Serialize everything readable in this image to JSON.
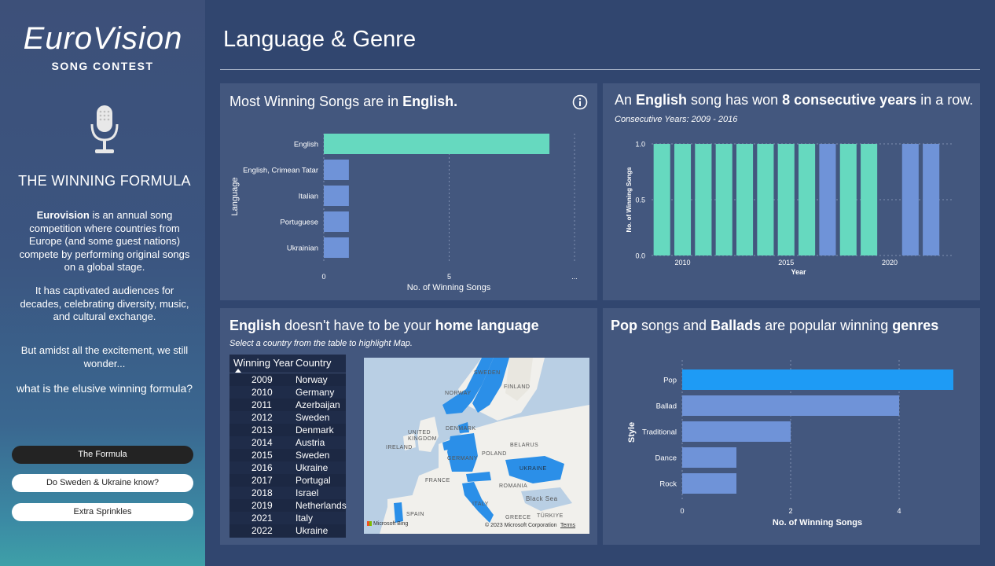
{
  "sidebar": {
    "logo_main": "EUROVISION",
    "logo_sub": "SONG CONTEST",
    "heading": "THE WINNING FORMULA",
    "intro_bold": "Eurovision",
    "intro_rest": " is an annual song competition where countries from Europe (and some guest nations) compete by performing original songs on a global stage.",
    "intro2": "It has captivated audiences for decades, celebrating diversity, music, and cultural exchange.",
    "intro3": "But amidst all the excitement, we still wonder...",
    "question": "what is the elusive winning formula?",
    "nav": [
      {
        "label": "The Formula",
        "active": true
      },
      {
        "label": "Do Sweden & Ukraine know?",
        "active": false
      },
      {
        "label": "Extra Sprinkles",
        "active": false
      }
    ]
  },
  "page_title": "Language & Genre",
  "cards": {
    "language": {
      "title_pre": "Most Winning Songs are in ",
      "title_bold": "English.",
      "ylabel": "Language",
      "xlabel": "No. of Winning Songs",
      "ellipsis": "..."
    },
    "consecutive": {
      "title_pre": "An ",
      "title_b1": "English",
      "title_mid": " song has won ",
      "title_b2": "8 consecutive years",
      "title_post": " in a row.",
      "subtitle": "Consecutive Years: 2009 - 2016",
      "ylabel": "No. of Winning Songs",
      "xlabel": "Year"
    },
    "home_language": {
      "title_b1": "English",
      "title_mid": " doesn't have to be your ",
      "title_b2": "home language",
      "subtitle": "Select a country from the table to highlight Map.",
      "table_headers": [
        "Winning Year",
        "Country"
      ],
      "table_rows": [
        [
          "2009",
          "Norway"
        ],
        [
          "2010",
          "Germany"
        ],
        [
          "2011",
          "Azerbaijan"
        ],
        [
          "2012",
          "Sweden"
        ],
        [
          "2013",
          "Denmark"
        ],
        [
          "2014",
          "Austria"
        ],
        [
          "2015",
          "Sweden"
        ],
        [
          "2016",
          "Ukraine"
        ],
        [
          "2017",
          "Portugal"
        ],
        [
          "2018",
          "Israel"
        ],
        [
          "2019",
          "Netherlands"
        ],
        [
          "2021",
          "Italy"
        ],
        [
          "2022",
          "Ukraine"
        ]
      ],
      "map_labels": [
        "SWEDEN",
        "FINLAND",
        "NORWAY",
        "DENMARK",
        "UNITED KINGDOM",
        "IRELAND",
        "BELARUS",
        "GERMANY",
        "POLAND",
        "UKRAINE",
        "FRANCE",
        "ROMANIA",
        "Black Sea",
        "SPAIN",
        "ITALY",
        "GREECE",
        "TÜRKIYE"
      ],
      "map_credit": "© 2023 Microsoft Corporation",
      "map_terms": "Terms",
      "map_brand": "Microsoft Bing"
    },
    "genres": {
      "title_b1": "Pop",
      "title_mid1": " songs and ",
      "title_b2": "Ballads",
      "title_mid2": " are popular winning ",
      "title_b3": "genres",
      "ylabel": "Style",
      "xlabel": "No. of Winning Songs"
    }
  },
  "colors": {
    "teal": "#66d9bf",
    "blue": "#6f93d8",
    "bright_blue": "#1e9bf5",
    "card_bg": "#43577e",
    "page_bg": "#31466f"
  },
  "chart_data": [
    {
      "type": "bar",
      "orientation": "horizontal",
      "categories": [
        "English",
        "English, Crimean Tatar",
        "Italian",
        "Portuguese",
        "Ukrainian"
      ],
      "values": [
        9,
        1,
        1,
        1,
        1
      ],
      "xlabel": "No. of Winning Songs",
      "ylabel": "Language",
      "xticks": [
        "0",
        "5",
        "..."
      ],
      "xlim": [
        0,
        10
      ]
    },
    {
      "type": "bar",
      "categories": [
        2009,
        2010,
        2011,
        2012,
        2013,
        2014,
        2015,
        2016,
        2017,
        2018,
        2019,
        2021,
        2022
      ],
      "values": [
        1,
        1,
        1,
        1,
        1,
        1,
        1,
        1,
        1,
        1,
        1,
        1,
        1
      ],
      "english": [
        true,
        true,
        true,
        true,
        true,
        true,
        true,
        true,
        false,
        true,
        true,
        false,
        false
      ],
      "xlabel": "Year",
      "ylabel": "No. of Winning Songs",
      "yticks": [
        "0.0",
        "0.5",
        "1.0"
      ],
      "xticks": [
        "2010",
        "2015",
        "2020"
      ],
      "ylim": [
        0,
        1
      ]
    },
    {
      "type": "bar",
      "orientation": "horizontal",
      "categories": [
        "Pop",
        "Ballad",
        "Traditional",
        "Dance",
        "Rock"
      ],
      "values": [
        5,
        4,
        2,
        1,
        1
      ],
      "xlabel": "No. of Winning Songs",
      "ylabel": "Style",
      "xticks": [
        "0",
        "2",
        "4"
      ],
      "xlim": [
        0,
        5
      ]
    }
  ]
}
